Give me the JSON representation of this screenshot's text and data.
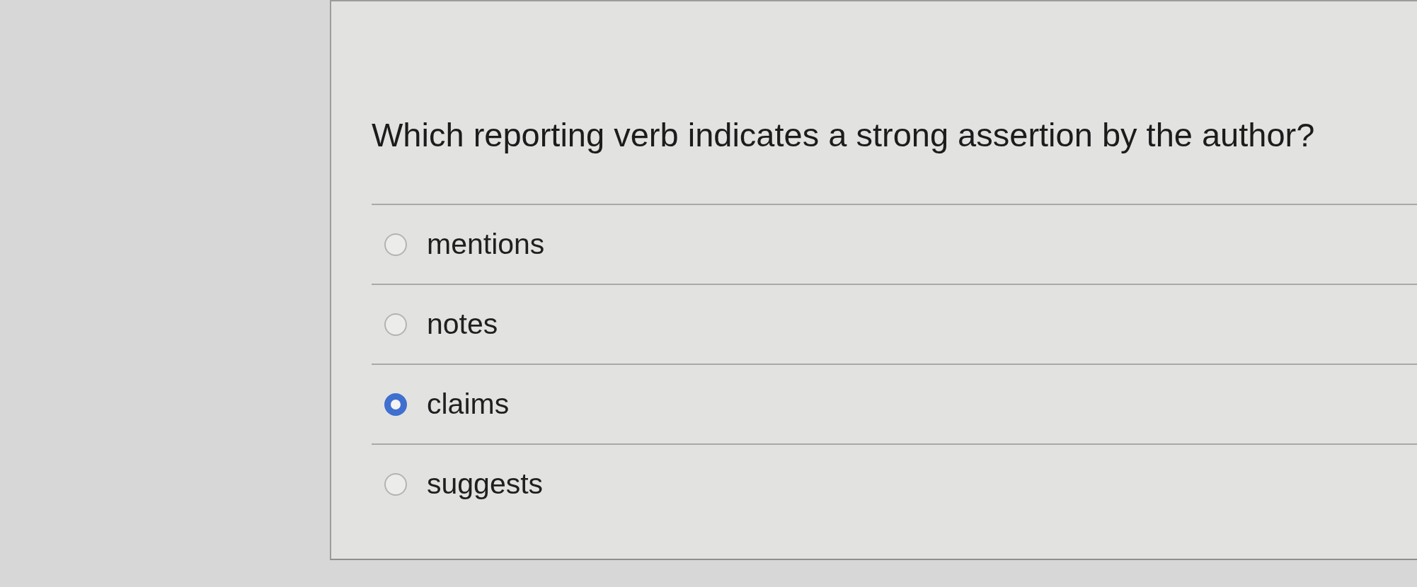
{
  "question": {
    "text": "Which reporting verb indicates a strong assertion by the author?"
  },
  "options": [
    {
      "label": "mentions",
      "selected": false
    },
    {
      "label": "notes",
      "selected": false
    },
    {
      "label": "claims",
      "selected": true
    },
    {
      "label": "suggests",
      "selected": false
    }
  ]
}
